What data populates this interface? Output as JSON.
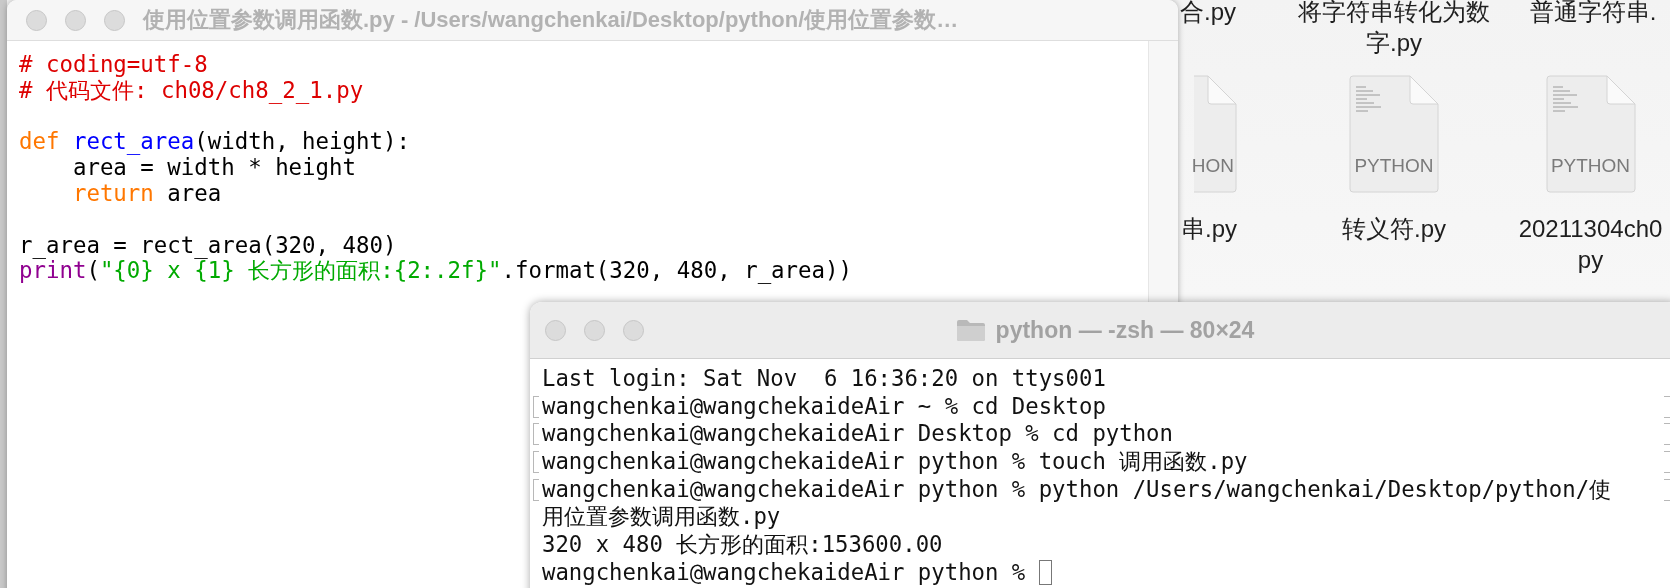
{
  "desktop": {
    "items": [
      {
        "label": "合.py"
      },
      {
        "label": "将字符串转化为数字.py"
      },
      {
        "label": "普通字符串."
      },
      {
        "label": "串.py",
        "icon_label": "HON"
      },
      {
        "label": "转义符.py",
        "icon_label": "PYTHON"
      },
      {
        "label": "20211304ch0\npy",
        "icon_label": "PYTHON"
      }
    ]
  },
  "editor": {
    "title": "使用位置参数调用函数.py - /Users/wangchenkai/Desktop/python/使用位置参数…",
    "lines": [
      {
        "tokens": [
          {
            "text": "# coding=utf-8",
            "kind": "comment"
          }
        ]
      },
      {
        "tokens": [
          {
            "text": "# 代码文件: ch08/ch8_2_1.py",
            "kind": "comment"
          }
        ]
      },
      {
        "space_before": true,
        "tokens": [
          {
            "text": "def ",
            "kind": "keyword"
          },
          {
            "text": "rect_area",
            "kind": "definition"
          },
          {
            "text": "(width, height):",
            "kind": "plain"
          }
        ]
      },
      {
        "tokens": [
          {
            "text": "    area = width * height",
            "kind": "plain"
          }
        ]
      },
      {
        "tokens": [
          {
            "text": "    return",
            "kind": "keyword"
          },
          {
            "text": " area",
            "kind": "plain"
          }
        ]
      },
      {
        "space_before": true,
        "tokens": [
          {
            "text": "r_area = rect_area(320, 480)",
            "kind": "plain"
          }
        ]
      },
      {
        "tokens": [
          {
            "text": "print",
            "kind": "builtin"
          },
          {
            "text": "(",
            "kind": "plain"
          },
          {
            "text": "\"{0} x {1} 长方形的面积:{2:.2f}\"",
            "kind": "string"
          },
          {
            "text": ".format(320, 480, r_area))",
            "kind": "plain"
          }
        ]
      }
    ]
  },
  "terminal": {
    "title": "python — -zsh — 80×24",
    "lines": [
      {
        "text": "Last login: Sat Nov  6 16:36:20 on ttys001",
        "marked": false
      },
      {
        "text": "wangchenkai@wangchekaideAir ~ % cd Desktop",
        "marked": true
      },
      {
        "text": "wangchenkai@wangchekaideAir Desktop % cd python",
        "marked": true
      },
      {
        "text": "wangchenkai@wangchekaideAir python % touch 调用函数.py",
        "marked": true
      },
      {
        "text": "wangchenkai@wangchekaideAir python % python /Users/wangchenkai/Desktop/python/使",
        "marked": true
      },
      {
        "text": "用位置参数调用函数.py",
        "marked": false
      },
      {
        "text": "320 x 480 长方形的面积:153600.00",
        "marked": false
      },
      {
        "text": "wangchenkai@wangchekaideAir python % ",
        "marked": false,
        "cursor": true
      }
    ]
  }
}
